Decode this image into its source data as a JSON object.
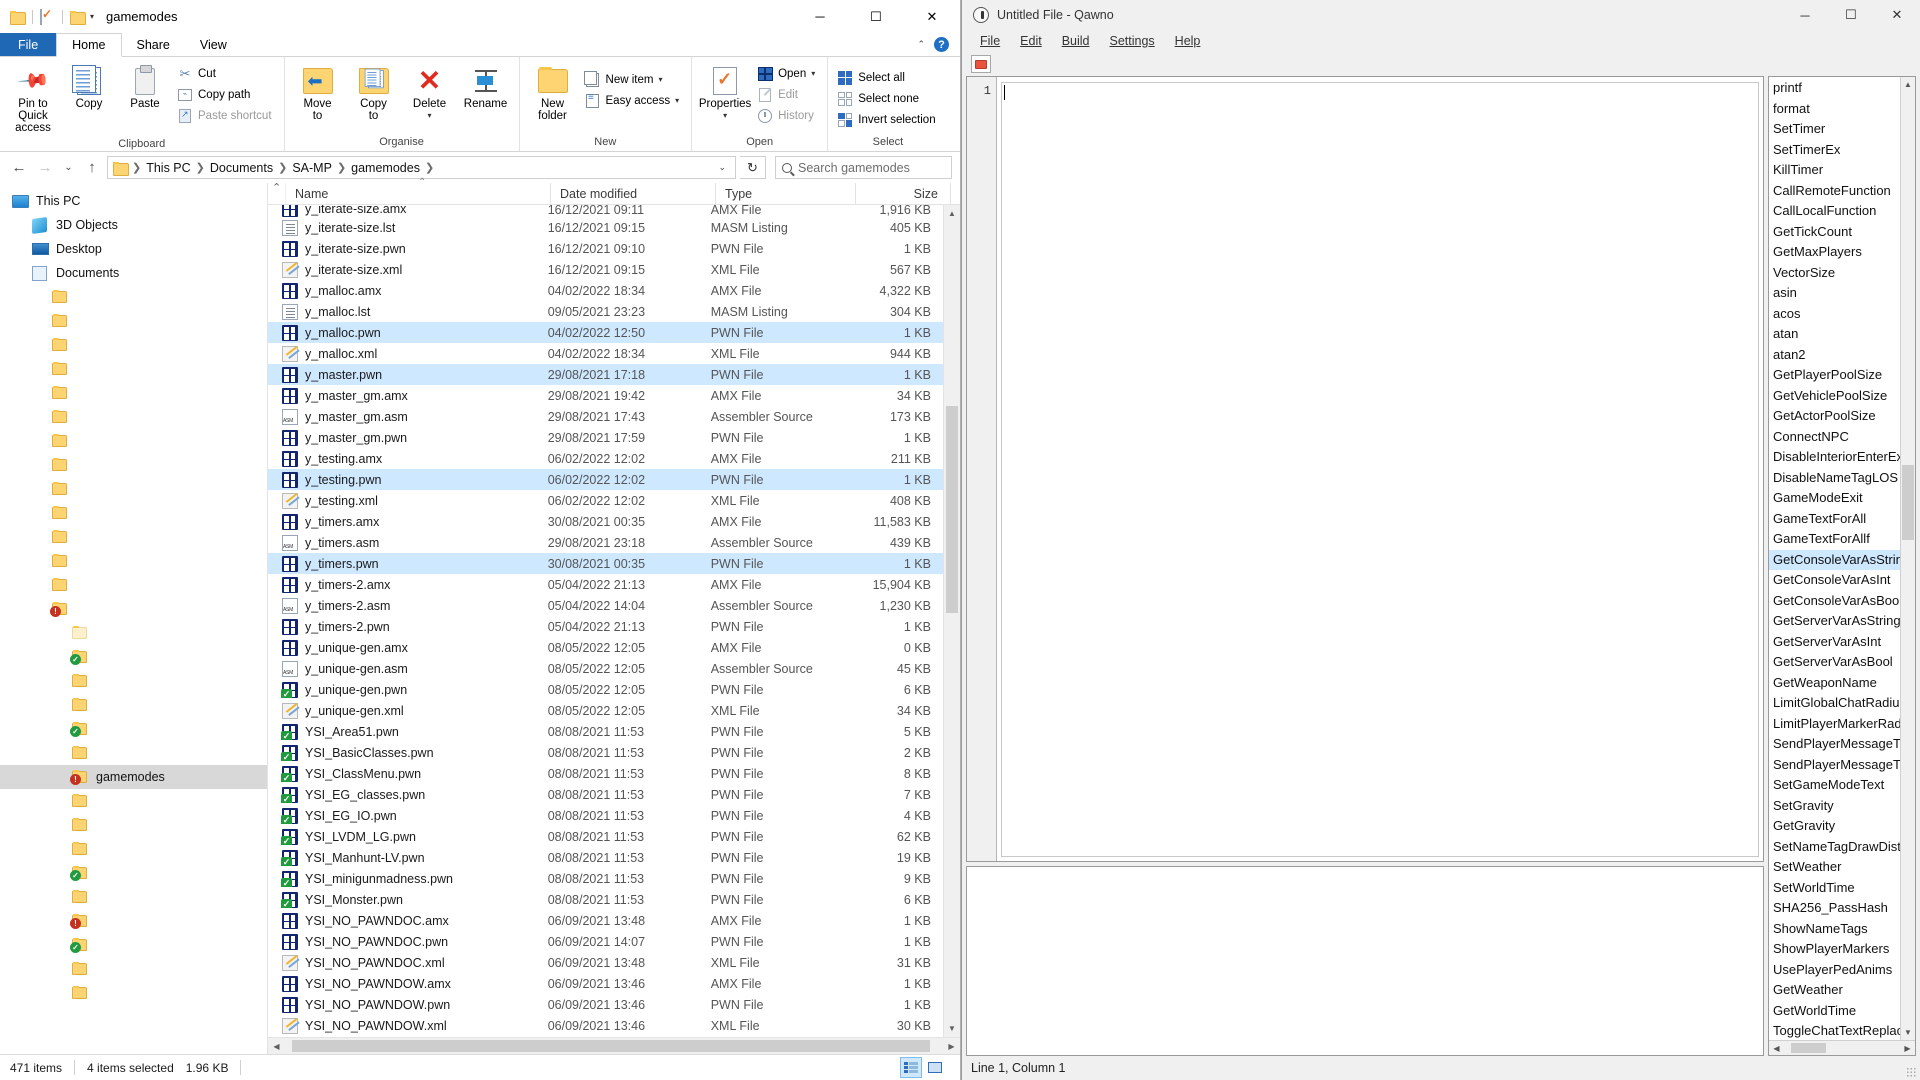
{
  "explorer": {
    "title": "gamemodes",
    "quick_access": [
      "folder-icon",
      "properties-icon",
      "folder-icon",
      "chevron-down-icon"
    ],
    "window_buttons": {
      "minimize": "─",
      "maximize": "☐",
      "close": "✕"
    },
    "tabs": [
      {
        "label": "File",
        "kind": "file"
      },
      {
        "label": "Home",
        "kind": "active"
      },
      {
        "label": "Share",
        "kind": "normal"
      },
      {
        "label": "View",
        "kind": "normal"
      }
    ],
    "ribbon": {
      "groups": [
        {
          "label": "Clipboard",
          "big": [
            {
              "label": "Pin to Quick\naccess",
              "icon": "pin-icon"
            },
            {
              "label": "Copy",
              "icon": "copy-icon"
            },
            {
              "label": "Paste",
              "icon": "paste-icon"
            }
          ],
          "small": [
            {
              "label": "Cut",
              "icon": "scissors-icon",
              "dim": false
            },
            {
              "label": "Copy path",
              "icon": "copy-path-icon",
              "dim": false
            },
            {
              "label": "Paste shortcut",
              "icon": "paste-shortcut-icon",
              "dim": true
            }
          ]
        },
        {
          "label": "Organise",
          "big": [
            {
              "label": "Move\nto",
              "icon": "move-to-icon",
              "dropdown": true
            },
            {
              "label": "Copy\nto",
              "icon": "copy-to-icon",
              "dropdown": true
            },
            {
              "label": "Delete",
              "icon": "delete-x-icon",
              "dropdown": true
            },
            {
              "label": "Rename",
              "icon": "rename-icon"
            }
          ],
          "small": []
        },
        {
          "label": "New",
          "big": [
            {
              "label": "New\nfolder",
              "icon": "new-folder-icon"
            }
          ],
          "small": [
            {
              "label": "New item",
              "icon": "new-item-icon",
              "dropdown": true
            },
            {
              "label": "Easy access",
              "icon": "easy-access-icon",
              "dropdown": true
            }
          ]
        },
        {
          "label": "Open",
          "big": [
            {
              "label": "Properties",
              "icon": "properties-icon",
              "dropdown": true
            }
          ],
          "small": [
            {
              "label": "Open",
              "icon": "open-icon",
              "dropdown": true,
              "dim": false
            },
            {
              "label": "Edit",
              "icon": "edit-icon",
              "dim": true
            },
            {
              "label": "History",
              "icon": "history-icon",
              "dim": true
            }
          ]
        },
        {
          "label": "Select",
          "big": [],
          "small": [
            {
              "label": "Select all",
              "icon": "select-all-icon"
            },
            {
              "label": "Select none",
              "icon": "select-none-icon"
            },
            {
              "label": "Invert selection",
              "icon": "invert-selection-icon"
            }
          ]
        }
      ]
    },
    "address": {
      "back": "←",
      "forward": "→",
      "recent": "⌄",
      "up": "↑",
      "crumbs": [
        "This PC",
        "Documents",
        "SA-MP",
        "gamemodes"
      ],
      "refresh": "↻"
    },
    "search": {
      "placeholder": "Search gamemodes",
      "value": ""
    },
    "nav_pane": {
      "items": [
        {
          "label": "This PC",
          "icon": "pc-icon",
          "indent": 0,
          "selected": false
        },
        {
          "label": "3D Objects",
          "icon": "3d-objects-icon",
          "indent": 1,
          "selected": false
        },
        {
          "label": "Desktop",
          "icon": "desktop-icon",
          "indent": 1,
          "selected": false
        },
        {
          "label": "Documents",
          "icon": "documents-icon",
          "indent": 1,
          "selected": false
        },
        {
          "label": "",
          "icon": "folder-icon",
          "indent": 2,
          "selected": false
        },
        {
          "label": "",
          "icon": "folder-icon",
          "indent": 2,
          "selected": false
        },
        {
          "label": "",
          "icon": "folder-icon",
          "indent": 2,
          "selected": false
        },
        {
          "label": "",
          "icon": "folder-icon",
          "indent": 2,
          "selected": false
        },
        {
          "label": "",
          "icon": "folder-icon",
          "indent": 2,
          "selected": false
        },
        {
          "label": "",
          "icon": "folder-icon",
          "indent": 2,
          "selected": false
        },
        {
          "label": "",
          "icon": "folder-icon",
          "indent": 2,
          "selected": false
        },
        {
          "label": "",
          "icon": "folder-icon",
          "indent": 2,
          "selected": false
        },
        {
          "label": "",
          "icon": "folder-icon",
          "indent": 2,
          "selected": false
        },
        {
          "label": "",
          "icon": "folder-icon",
          "indent": 2,
          "selected": false
        },
        {
          "label": "",
          "icon": "folder-icon",
          "indent": 2,
          "selected": false
        },
        {
          "label": "",
          "icon": "folder-icon",
          "indent": 2,
          "selected": false
        },
        {
          "label": "",
          "icon": "folder-icon",
          "indent": 2,
          "selected": false
        },
        {
          "label": "",
          "icon": "folder-error-icon",
          "indent": 2,
          "selected": false
        },
        {
          "label": "",
          "icon": "folder-pale-icon",
          "indent": 3,
          "selected": false
        },
        {
          "label": "",
          "icon": "folder-synced-icon",
          "indent": 3,
          "selected": false
        },
        {
          "label": "",
          "icon": "folder-icon",
          "indent": 3,
          "selected": false
        },
        {
          "label": "",
          "icon": "folder-icon",
          "indent": 3,
          "selected": false
        },
        {
          "label": "",
          "icon": "folder-synced-icon",
          "indent": 3,
          "selected": false
        },
        {
          "label": "",
          "icon": "folder-icon",
          "indent": 3,
          "selected": false
        },
        {
          "label": "gamemodes",
          "icon": "folder-error-icon",
          "indent": 3,
          "selected": true
        },
        {
          "label": "",
          "icon": "folder-icon",
          "indent": 3,
          "selected": false
        },
        {
          "label": "",
          "icon": "folder-icon",
          "indent": 3,
          "selected": false
        },
        {
          "label": "",
          "icon": "folder-icon",
          "indent": 3,
          "selected": false
        },
        {
          "label": "",
          "icon": "folder-synced-icon",
          "indent": 3,
          "selected": false
        },
        {
          "label": "",
          "icon": "folder-icon",
          "indent": 3,
          "selected": false
        },
        {
          "label": "",
          "icon": "folder-error-icon",
          "indent": 3,
          "selected": false
        },
        {
          "label": "",
          "icon": "folder-synced-icon",
          "indent": 3,
          "selected": false
        },
        {
          "label": "",
          "icon": "folder-icon",
          "indent": 3,
          "selected": false
        },
        {
          "label": "",
          "icon": "folder-icon",
          "indent": 3,
          "selected": false
        }
      ]
    },
    "columns": [
      "Name",
      "Date modified",
      "Type",
      "Size"
    ],
    "files": [
      {
        "name": "y_iterate-size.amx",
        "date": "16/12/2021 09:11",
        "type": "AMX File",
        "size": "1,916 KB",
        "icon": "amx-icon",
        "selected": false,
        "clipped": true
      },
      {
        "name": "y_iterate-size.lst",
        "date": "16/12/2021 09:15",
        "type": "MASM Listing",
        "size": "405 KB",
        "icon": "lst-icon",
        "selected": false
      },
      {
        "name": "y_iterate-size.pwn",
        "date": "16/12/2021 09:10",
        "type": "PWN File",
        "size": "1 KB",
        "icon": "pwn-icon",
        "selected": false
      },
      {
        "name": "y_iterate-size.xml",
        "date": "16/12/2021 09:15",
        "type": "XML File",
        "size": "567 KB",
        "icon": "xml-icon",
        "selected": false
      },
      {
        "name": "y_malloc.amx",
        "date": "04/02/2022 18:34",
        "type": "AMX File",
        "size": "4,322 KB",
        "icon": "amx-icon",
        "selected": false
      },
      {
        "name": "y_malloc.lst",
        "date": "09/05/2021 23:23",
        "type": "MASM Listing",
        "size": "304 KB",
        "icon": "lst-icon",
        "selected": false
      },
      {
        "name": "y_malloc.pwn",
        "date": "04/02/2022 12:50",
        "type": "PWN File",
        "size": "1 KB",
        "icon": "pwn-icon",
        "selected": true
      },
      {
        "name": "y_malloc.xml",
        "date": "04/02/2022 18:34",
        "type": "XML File",
        "size": "944 KB",
        "icon": "xml-icon",
        "selected": false
      },
      {
        "name": "y_master.pwn",
        "date": "29/08/2021 17:18",
        "type": "PWN File",
        "size": "1 KB",
        "icon": "pwn-icon",
        "selected": true
      },
      {
        "name": "y_master_gm.amx",
        "date": "29/08/2021 19:42",
        "type": "AMX File",
        "size": "34 KB",
        "icon": "amx-icon",
        "selected": false
      },
      {
        "name": "y_master_gm.asm",
        "date": "29/08/2021 17:43",
        "type": "Assembler Source",
        "size": "173 KB",
        "icon": "asm-icon",
        "selected": false
      },
      {
        "name": "y_master_gm.pwn",
        "date": "29/08/2021 17:59",
        "type": "PWN File",
        "size": "1 KB",
        "icon": "pwn-icon",
        "selected": false
      },
      {
        "name": "y_testing.amx",
        "date": "06/02/2022 12:02",
        "type": "AMX File",
        "size": "211 KB",
        "icon": "amx-icon",
        "selected": false
      },
      {
        "name": "y_testing.pwn",
        "date": "06/02/2022 12:02",
        "type": "PWN File",
        "size": "1 KB",
        "icon": "pwn-icon",
        "selected": true
      },
      {
        "name": "y_testing.xml",
        "date": "06/02/2022 12:02",
        "type": "XML File",
        "size": "408 KB",
        "icon": "xml-icon",
        "selected": false
      },
      {
        "name": "y_timers.amx",
        "date": "30/08/2021 00:35",
        "type": "AMX File",
        "size": "11,583 KB",
        "icon": "amx-icon",
        "selected": false
      },
      {
        "name": "y_timers.asm",
        "date": "29/08/2021 23:18",
        "type": "Assembler Source",
        "size": "439 KB",
        "icon": "asm-icon",
        "selected": false
      },
      {
        "name": "y_timers.pwn",
        "date": "30/08/2021 00:35",
        "type": "PWN File",
        "size": "1 KB",
        "icon": "pwn-icon",
        "selected": true
      },
      {
        "name": "y_timers-2.amx",
        "date": "05/04/2022 21:13",
        "type": "AMX File",
        "size": "15,904 KB",
        "icon": "amx-icon",
        "selected": false
      },
      {
        "name": "y_timers-2.asm",
        "date": "05/04/2022 14:04",
        "type": "Assembler Source",
        "size": "1,230 KB",
        "icon": "asm-icon",
        "selected": false
      },
      {
        "name": "y_timers-2.pwn",
        "date": "05/04/2022 21:13",
        "type": "PWN File",
        "size": "1 KB",
        "icon": "pwn-icon",
        "selected": false
      },
      {
        "name": "y_unique-gen.amx",
        "date": "08/05/2022 12:05",
        "type": "AMX File",
        "size": "0 KB",
        "icon": "amx-icon",
        "selected": false
      },
      {
        "name": "y_unique-gen.asm",
        "date": "08/05/2022 12:05",
        "type": "Assembler Source",
        "size": "45 KB",
        "icon": "asm-icon",
        "selected": false
      },
      {
        "name": "y_unique-gen.pwn",
        "date": "08/05/2022 12:05",
        "type": "PWN File",
        "size": "6 KB",
        "icon": "pwn-ok-icon",
        "selected": false
      },
      {
        "name": "y_unique-gen.xml",
        "date": "08/05/2022 12:05",
        "type": "XML File",
        "size": "34 KB",
        "icon": "xml-icon",
        "selected": false
      },
      {
        "name": "YSI_Area51.pwn",
        "date": "08/08/2021 11:53",
        "type": "PWN File",
        "size": "5 KB",
        "icon": "pwn-ok-icon",
        "selected": false
      },
      {
        "name": "YSI_BasicClasses.pwn",
        "date": "08/08/2021 11:53",
        "type": "PWN File",
        "size": "2 KB",
        "icon": "pwn-ok-icon",
        "selected": false
      },
      {
        "name": "YSI_ClassMenu.pwn",
        "date": "08/08/2021 11:53",
        "type": "PWN File",
        "size": "8 KB",
        "icon": "pwn-ok-icon",
        "selected": false
      },
      {
        "name": "YSI_EG_classes.pwn",
        "date": "08/08/2021 11:53",
        "type": "PWN File",
        "size": "7 KB",
        "icon": "pwn-ok-icon",
        "selected": false
      },
      {
        "name": "YSI_EG_IO.pwn",
        "date": "08/08/2021 11:53",
        "type": "PWN File",
        "size": "4 KB",
        "icon": "pwn-ok-icon",
        "selected": false
      },
      {
        "name": "YSI_LVDM_LG.pwn",
        "date": "08/08/2021 11:53",
        "type": "PWN File",
        "size": "62 KB",
        "icon": "pwn-ok-icon",
        "selected": false
      },
      {
        "name": "YSI_Manhunt-LV.pwn",
        "date": "08/08/2021 11:53",
        "type": "PWN File",
        "size": "19 KB",
        "icon": "pwn-ok-icon",
        "selected": false
      },
      {
        "name": "YSI_minigunmadness.pwn",
        "date": "08/08/2021 11:53",
        "type": "PWN File",
        "size": "9 KB",
        "icon": "pwn-ok-icon",
        "selected": false
      },
      {
        "name": "YSI_Monster.pwn",
        "date": "08/08/2021 11:53",
        "type": "PWN File",
        "size": "6 KB",
        "icon": "pwn-ok-icon",
        "selected": false
      },
      {
        "name": "YSI_NO_PAWNDOC.amx",
        "date": "06/09/2021 13:48",
        "type": "AMX File",
        "size": "1 KB",
        "icon": "amx-icon",
        "selected": false
      },
      {
        "name": "YSI_NO_PAWNDOC.pwn",
        "date": "06/09/2021 14:07",
        "type": "PWN File",
        "size": "1 KB",
        "icon": "pwn-icon",
        "selected": false
      },
      {
        "name": "YSI_NO_PAWNDOC.xml",
        "date": "06/09/2021 13:48",
        "type": "XML File",
        "size": "31 KB",
        "icon": "xml-icon",
        "selected": false
      },
      {
        "name": "YSI_NO_PAWNDOW.amx",
        "date": "06/09/2021 13:46",
        "type": "AMX File",
        "size": "1 KB",
        "icon": "amx-icon",
        "selected": false
      },
      {
        "name": "YSI_NO_PAWNDOW.pwn",
        "date": "06/09/2021 13:46",
        "type": "PWN File",
        "size": "1 KB",
        "icon": "pwn-icon",
        "selected": false
      },
      {
        "name": "YSI_NO_PAWNDOW.xml",
        "date": "06/09/2021 13:46",
        "type": "XML File",
        "size": "30 KB",
        "icon": "xml-icon",
        "selected": false
      }
    ],
    "status": {
      "items_count": "471 items",
      "selection": "4 items selected",
      "selection_size": "1.96 KB"
    },
    "view_buttons": [
      {
        "name": "details-view",
        "active": true
      },
      {
        "name": "large-icons-view",
        "active": false
      }
    ]
  },
  "qawno": {
    "title": "Untitled File - Qawno",
    "window_buttons": {
      "minimize": "─",
      "maximize": "☐",
      "close": "✕"
    },
    "menus": [
      "File",
      "Edit",
      "Build",
      "Settings",
      "Help"
    ],
    "toolbar": [
      {
        "name": "compile-button",
        "icon": "compile-icon"
      }
    ],
    "editor": {
      "line_numbers": [
        "1"
      ],
      "content": ""
    },
    "functions": [
      "printf",
      "format",
      "SetTimer",
      "SetTimerEx",
      "KillTimer",
      "CallRemoteFunction",
      "CallLocalFunction",
      "GetTickCount",
      "GetMaxPlayers",
      "VectorSize",
      "asin",
      "acos",
      "atan",
      "atan2",
      "GetPlayerPoolSize",
      "GetVehiclePoolSize",
      "GetActorPoolSize",
      "ConnectNPC",
      "DisableInteriorEnterExits",
      "DisableNameTagLOS",
      "GameModeExit",
      "GameTextForAll",
      "GameTextForAllf",
      "GetConsoleVarAsString",
      "GetConsoleVarAsInt",
      "GetConsoleVarAsBool",
      "GetServerVarAsString",
      "GetServerVarAsInt",
      "GetServerVarAsBool",
      "GetWeaponName",
      "LimitGlobalChatRadius",
      "LimitPlayerMarkerRadius",
      "SendPlayerMessageToAll",
      "SendPlayerMessageToPlayer",
      "SetGameModeText",
      "SetGravity",
      "GetGravity",
      "SetNameTagDrawDistance",
      "SetWeather",
      "SetWorldTime",
      "SHA256_PassHash",
      "ShowNameTags",
      "ShowPlayerMarkers",
      "UsePlayerPedAnims",
      "GetWeather",
      "GetWorldTime",
      "ToggleChatTextReplacement"
    ],
    "selected_function": "GetConsoleVarAsString",
    "status": "Line 1, Column 1"
  }
}
